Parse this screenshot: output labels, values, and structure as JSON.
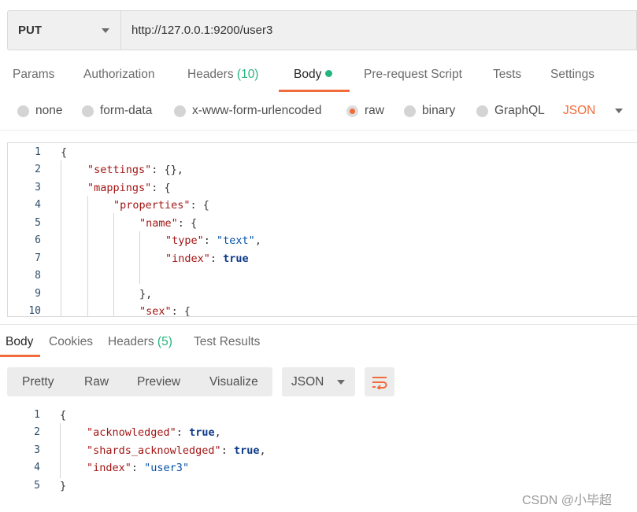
{
  "request": {
    "method": "PUT",
    "url": "http://127.0.0.1:9200/user3"
  },
  "request_tabs": {
    "params": "Params",
    "authorization": "Authorization",
    "headers_label": "Headers",
    "headers_count": "(10)",
    "body": "Body",
    "pre_request": "Pre-request Script",
    "tests": "Tests",
    "settings": "Settings"
  },
  "body_types": {
    "none": "none",
    "form_data": "form-data",
    "urlencoded": "x-www-form-urlencoded",
    "raw": "raw",
    "binary": "binary",
    "graphql": "GraphQL",
    "selected": "raw",
    "language": "JSON"
  },
  "request_editor": {
    "line_numbers": [
      "1",
      "2",
      "3",
      "4",
      "5",
      "6",
      "7",
      "8",
      "9",
      "10"
    ],
    "tokens": {
      "l1_open": "{",
      "l2_key": "\"settings\"",
      "l2_rest": ": {},",
      "l3_key": "\"mappings\"",
      "l3_rest": ": {",
      "l4_key": "\"properties\"",
      "l4_rest": ": {",
      "l5_key": "\"name\"",
      "l5_rest": ": {",
      "l6_key": "\"type\"",
      "l6_colon": ": ",
      "l6_val": "\"text\"",
      "l6_comma": ",",
      "l7_key": "\"index\"",
      "l7_colon": ": ",
      "l7_val": "true",
      "l9_close": "},",
      "l10_key": "\"sex\"",
      "l10_rest": ": {"
    }
  },
  "response_tabs": {
    "body": "Body",
    "cookies": "Cookies",
    "headers_label": "Headers",
    "headers_count": "(5)",
    "test_results": "Test Results"
  },
  "response_toolbar": {
    "pretty": "Pretty",
    "raw": "Raw",
    "preview": "Preview",
    "visualize": "Visualize",
    "format": "JSON"
  },
  "response_editor": {
    "line_numbers": [
      "1",
      "2",
      "3",
      "4",
      "5"
    ],
    "tokens": {
      "l1_open": "{",
      "l2_key": "\"acknowledged\"",
      "l2_colon": ": ",
      "l2_val": "true",
      "l2_comma": ",",
      "l3_key": "\"shards_acknowledged\"",
      "l3_colon": ": ",
      "l3_val": "true",
      "l3_comma": ",",
      "l4_key": "\"index\"",
      "l4_colon": ": ",
      "l4_val": "\"user3\"",
      "l5_close": "}"
    }
  },
  "watermark": "CSDN @小毕超",
  "colors": {
    "accent": "#f26b3a",
    "count_green": "#26b47f",
    "json_key": "#a31515",
    "json_string": "#0451a5",
    "json_bool": "#0d3a8a"
  },
  "icons": {
    "method_dropdown": "chevron-down-icon",
    "wrap": "wrap-lines-icon"
  }
}
